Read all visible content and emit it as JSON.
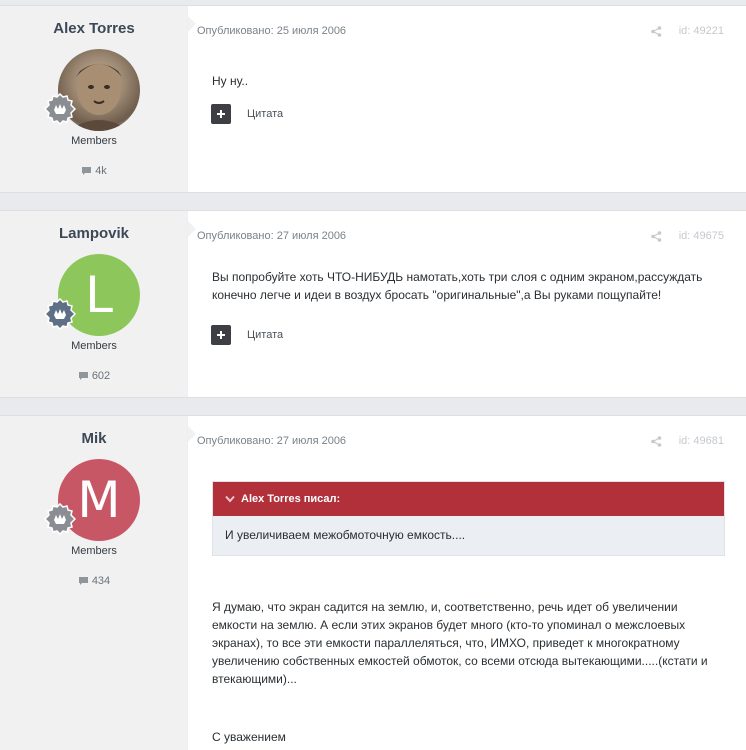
{
  "posts": [
    {
      "author": "Alex Torres",
      "group": "Members",
      "post_count": "4k",
      "date": "Опубликовано: 25 июля 2006",
      "id": "id: 49221",
      "paragraphs": [
        "Ну ну.."
      ],
      "quote_label": "Цитата",
      "avatar_type": "photo"
    },
    {
      "author": "Lampovik",
      "group": "Members",
      "post_count": "602",
      "date": "Опубликовано: 27 июля 2006",
      "id": "id: 49675",
      "avatar_letter": "L",
      "avatar_color": "#8dc65a",
      "paragraphs": [
        "Вы попробуйте хоть ЧТО-НИБУДЬ намотать,хоть три слоя с одним экраном,рассуждать",
        "конечно легче и идеи в воздух бросать \"оригинальные\",а Вы руками пощупайте!"
      ],
      "quote_label": "Цитата"
    },
    {
      "author": "Mik",
      "group": "Members",
      "post_count": "434",
      "date": "Опубликовано: 27 июля 2006",
      "id": "id: 49681",
      "avatar_letter": "M",
      "avatar_color": "#c85766",
      "quote": {
        "citation": "Alex Torres писал:",
        "text": "И увеличиваем межобмоточную емкость...."
      },
      "paragraphs": [
        "Я думаю, что экран садится на землю, и, соответственно, речь идет об увеличении",
        "емкости на землю. А если этих экранов будет много (кто-то упоминал о межслоевых",
        "экранах), то все эти емкости параллеляться, что, ИМХО, приведет к многократному",
        "увеличению собственных емкостей обмоток, со всеми отсюда вытекающими.....(кстати и",
        "втекающими)..."
      ],
      "signature": "С уважением"
    }
  ],
  "icons": {
    "share": "share-icon",
    "comment": "comment-icon",
    "rank": "rank-badge-icon",
    "plus": "plus-icon",
    "chevron": "chevron-down-icon"
  },
  "colors": {
    "quote_header": "#b2303a",
    "author_panel": "#f1f1f2"
  }
}
